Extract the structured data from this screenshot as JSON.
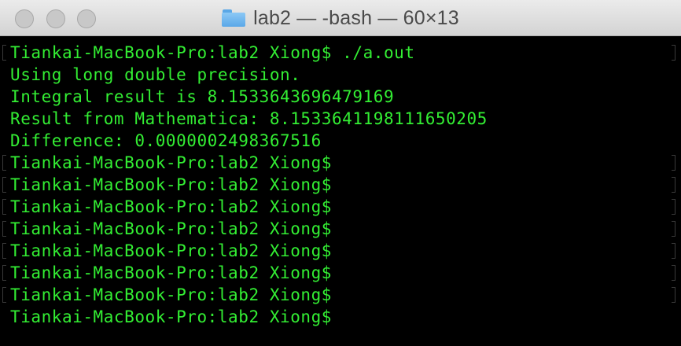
{
  "window": {
    "title": "lab2 — -bash — 60×13",
    "folder_icon": "folder-icon"
  },
  "colors": {
    "terminal_bg": "#000000",
    "terminal_text": "#33ee33",
    "titlebar_bg": "#e0e0e0"
  },
  "terminal": {
    "lines": [
      "Tiankai-MacBook-Pro:lab2 Xiong$ ./a.out",
      "Using long double precision.",
      "Integral result is 8.1533643696479169",
      "Result from Mathematica: 8.1533641198111650205",
      "Difference: 0.0000002498367516",
      "Tiankai-MacBook-Pro:lab2 Xiong$",
      "Tiankai-MacBook-Pro:lab2 Xiong$",
      "Tiankai-MacBook-Pro:lab2 Xiong$",
      "Tiankai-MacBook-Pro:lab2 Xiong$",
      "Tiankai-MacBook-Pro:lab2 Xiong$",
      "Tiankai-MacBook-Pro:lab2 Xiong$",
      "Tiankai-MacBook-Pro:lab2 Xiong$",
      "Tiankai-MacBook-Pro:lab2 Xiong$"
    ]
  }
}
